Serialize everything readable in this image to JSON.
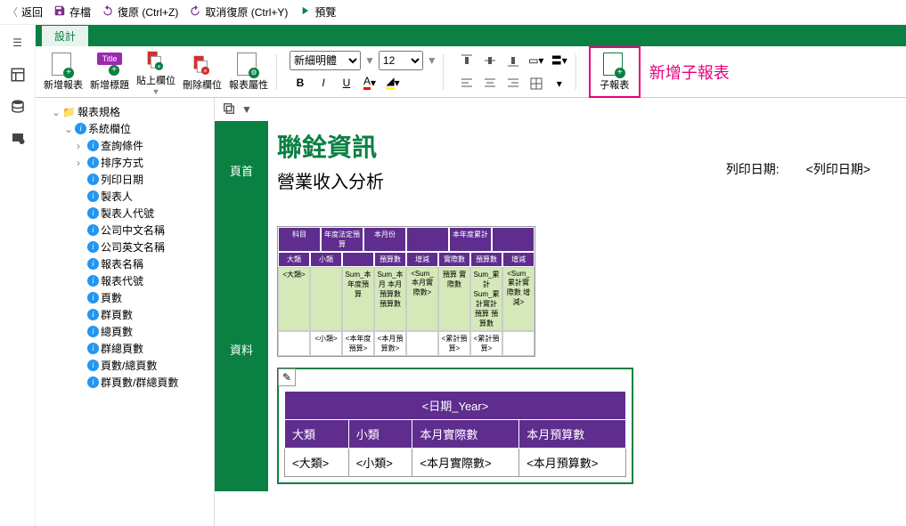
{
  "menubar": {
    "back": "返回",
    "save": "存檔",
    "undo": "復原 (Ctrl+Z)",
    "redo": "取消復原 (Ctrl+Y)",
    "preview": "預覽"
  },
  "tabs": {
    "design": "設計"
  },
  "ribbon": {
    "new_report": "新增報表",
    "new_title": "新增標題",
    "paste_field": "貼上欄位",
    "delete_field": "刪除欄位",
    "report_props": "報表屬性",
    "font_name": "新細明體",
    "font_size": "12",
    "sub_report": "子報表",
    "annotation": "新增子報表"
  },
  "tree": {
    "root": "報表規格",
    "sysfields": "系統欄位",
    "items": [
      "查詢條件",
      "排序方式",
      "列印日期",
      "製表人",
      "製表人代號",
      "公司中文名稱",
      "公司英文名稱",
      "報表名稱",
      "報表代號",
      "頁數",
      "群頁數",
      "總頁數",
      "群總頁數",
      "頁數/總頁數",
      "群頁數/群總頁數"
    ]
  },
  "sections": {
    "header": "頁首",
    "data": "資料"
  },
  "page_header": {
    "title": "聯銓資訊",
    "subtitle": "營業收入分析",
    "print_date_label": "列印日期:",
    "print_date_value": "<列印日期>"
  },
  "thumb": {
    "h1": [
      "科目",
      "年度法定預算",
      "本月份",
      "",
      "本年度累計",
      ""
    ],
    "h2": [
      "大類",
      "小類",
      "",
      "預算數",
      "增減",
      "實際數",
      "預算數",
      "增減"
    ],
    "r1": [
      "<大類>",
      "",
      "Sum_本年度預算",
      "Sum_本月 本月 預算數 預算數",
      "<Sum_本月實際數>",
      "預算 實際數",
      "Sum_累計 Sum_累計實計預算 預算數",
      "<Sum_累計實際數 增減>"
    ],
    "r2": [
      "",
      "<小類>",
      "<本年度預算>",
      "<本月預算數>",
      "",
      "<累計預算>",
      "<累計預算>",
      ""
    ]
  },
  "data_table": {
    "year_header": "<日期_Year>",
    "cols": [
      "大類",
      "小類",
      "本月實際數",
      "本月預算數"
    ],
    "row": [
      "<大類>",
      "<小類>",
      "<本月實際數>",
      "<本月預算數>"
    ]
  }
}
